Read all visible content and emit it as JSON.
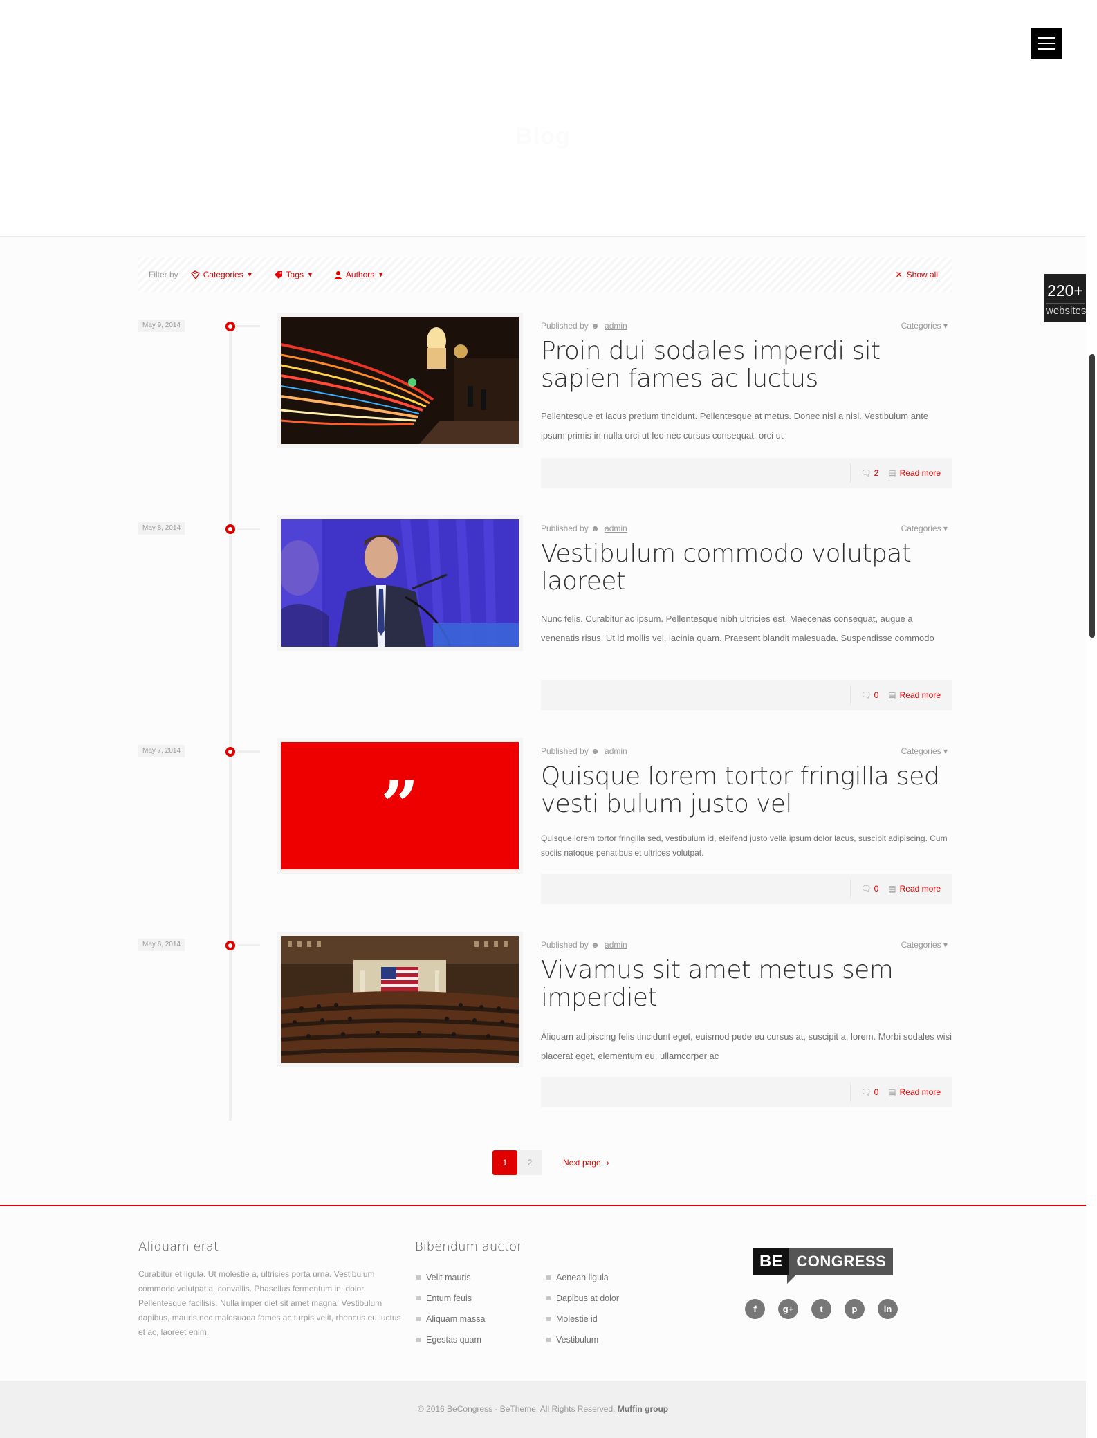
{
  "header": {
    "page_title": "Blog"
  },
  "side_badge": {
    "big": "220+",
    "small": "websites"
  },
  "filters": {
    "label": "Filter by",
    "categories": "Categories",
    "tags": "Tags",
    "authors": "Authors",
    "show_all": "Show all"
  },
  "posts": [
    {
      "date": "May 9, 2014",
      "published_by": "Published by",
      "author": "admin",
      "categories": "Categories",
      "title": "Proin dui sodales imperdi sit sapien fames ac luctus",
      "excerpt": "Pellentesque et lacus pretium tincidunt. Pellentesque at metus. Donec nisl a nisl. Vestibulum ante ipsum primis in nulla orci ut leo nec cursus consequat, orci ut",
      "comments": "2",
      "read_more": "Read more"
    },
    {
      "date": "May 8, 2014",
      "published_by": "Published by",
      "author": "admin",
      "categories": "Categories",
      "title": "Vestibulum commodo volutpat laoreet",
      "excerpt": "Nunc felis. Curabitur ac ipsum. Pellentesque nibh ultricies est. Maecenas consequat, augue a venenatis risus. Ut id mollis vel, lacinia quam. Praesent blandit malesuada. Suspendisse commodo",
      "comments": "0",
      "read_more": "Read more"
    },
    {
      "date": "May 7, 2014",
      "published_by": "Published by",
      "author": "admin",
      "categories": "Categories",
      "title": "Quisque lorem tortor fringilla sed vesti bulum justo vel",
      "excerpt": "Quisque lorem tortor fringilla sed, vestibulum id, eleifend justo vella ipsum dolor lacus, suscipit adipiscing. Cum sociis natoque penatibus et ultrices volutpat.",
      "quote_glyph": "”",
      "comments": "0",
      "read_more": "Read more"
    },
    {
      "date": "May 6, 2014",
      "published_by": "Published by",
      "author": "admin",
      "categories": "Categories",
      "title": "Vivamus sit amet metus sem imperdiet",
      "excerpt": "Aliquam adipiscing felis tincidunt eget, euismod pede eu cursus at, suscipit a, lorem. Morbi sodales wisi placerat eget, elementum eu, ullamcorper ac",
      "comments": "0",
      "read_more": "Read more"
    }
  ],
  "pagination": {
    "page1": "1",
    "page2": "2",
    "next": "Next page"
  },
  "footer": {
    "col1_title": "Aliquam erat",
    "col1_text": "Curabitur et ligula. Ut molestie a, ultricies porta urna. Vestibulum commodo volutpat a, convallis. Phasellus fermentum in, dolor. Pellentesque facilisis. Nulla imper diet sit amet magna. Vestibulum dapibus, mauris nec malesuada fames ac turpis velit, rhoncus eu luctus et ac, laoreet enim.",
    "col2_title": "Bibendum auctor",
    "list_a": [
      "Velit mauris",
      "Entum feuis",
      "Aliquam massa",
      "Egestas quam"
    ],
    "list_b": [
      "Aenean ligula",
      "Dapibus at dolor",
      "Molestie id",
      "Vestibulum"
    ],
    "logo_be": "BE",
    "logo_congress": "CONGRESS",
    "social": [
      "f",
      "g+",
      "t",
      "p",
      "in"
    ]
  },
  "copyright": {
    "text": "© 2016 BeCongress - BeTheme. All Rights Reserved. ",
    "link": "Muffin group"
  },
  "colors": {
    "accent": "#e00000",
    "dark": "#000000"
  }
}
